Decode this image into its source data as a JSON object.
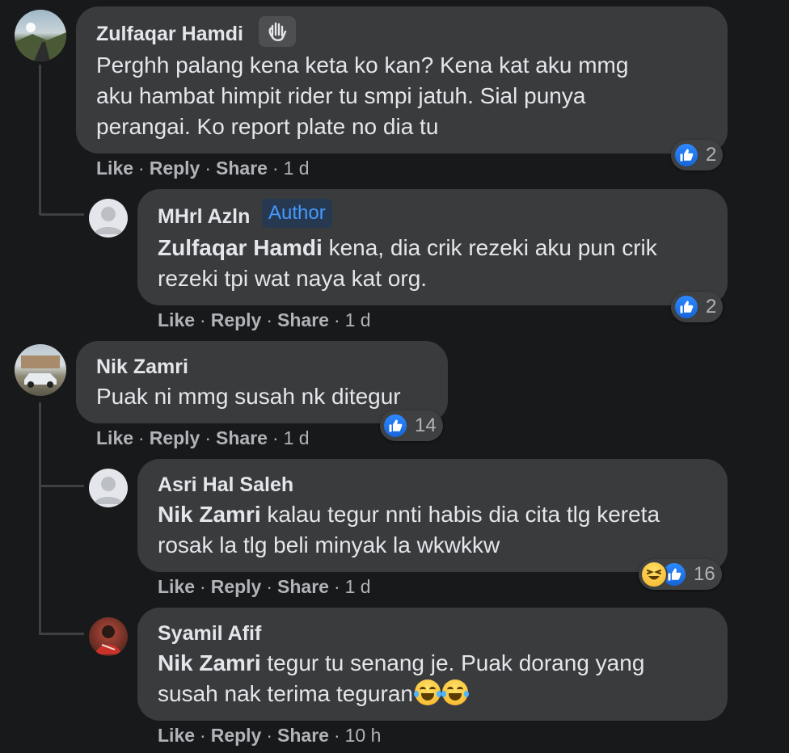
{
  "comments": [
    {
      "author": "Zulfaqar Hamdi",
      "lines": [
        "Perghh palang kena keta ko kan? Kena kat aku mmg",
        "aku hambat himpit rider tu smpi jatuh. Sial punya",
        "perangai. Ko report plate no dia tu"
      ],
      "reaction_count": "2",
      "time": "1 d",
      "fan_badge_icon": "waving-hand-icon"
    },
    {
      "author": "MHrl Azln",
      "author_badge": "Author",
      "mention": "Zulfaqar Hamdi",
      "lines": [
        " kena, dia crik rezeki aku pun crik",
        "rezeki tpi wat naya kat org."
      ],
      "reaction_count": "2",
      "time": "1 d"
    },
    {
      "author": "Nik Zamri",
      "lines": [
        "Puak ni mmg susah nk ditegur"
      ],
      "reaction_count": "14",
      "time": "1 d"
    },
    {
      "author": "Asri Hal Saleh",
      "mention": "Nik Zamri",
      "lines": [
        " kalau tegur nnti habis dia cita tlg kereta",
        "rosak la tlg beli minyak la wkwkkw"
      ],
      "reaction_count": "16",
      "time": "1 d"
    },
    {
      "author": "Syamil Afif",
      "mention": "Nik Zamri",
      "lines": [
        " tegur tu senang je. Puak dorang yang",
        "susah nak terima teguran"
      ],
      "time": "10 h"
    }
  ],
  "actions": {
    "like": "Like",
    "reply": "Reply",
    "share": "Share",
    "dot": "·"
  },
  "colors": {
    "bubble": "#3a3b3c",
    "background": "#18191a",
    "like_blue": "#2d88ff",
    "author_badge_text": "#4599ff"
  },
  "icons": {
    "like": "thumbs-up-icon",
    "haha": "laughing-face-icon",
    "tears": "tears-of-joy-icon"
  }
}
